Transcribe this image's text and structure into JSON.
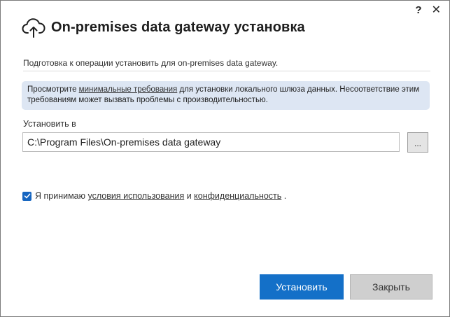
{
  "window": {
    "help_glyph": "?",
    "close_glyph": "✕",
    "title": "On-premises data gateway установка",
    "subtitle": "Подготовка к операции установить для on-premises data gateway."
  },
  "notice": {
    "prefix": "Просмотрите ",
    "link": "минимальные требования",
    "suffix": " для установки локального шлюза данных. Несоответствие этим требованиям может вызвать проблемы с производительностью."
  },
  "install": {
    "label": "Установить в",
    "path_value": "C:\\Program Files\\On-premises data gateway",
    "browse_label": "..."
  },
  "agreement": {
    "checked": true,
    "prefix": "Я принимаю ",
    "terms_link": "условия использования",
    "and": " и ",
    "privacy_link": "конфиденциальность",
    "suffix": " ."
  },
  "buttons": {
    "install": "Установить",
    "close": "Закрыть"
  },
  "colors": {
    "accent": "#1470c8",
    "notice_bg": "#dde6f3",
    "secondary_button": "#cfcfcf"
  }
}
